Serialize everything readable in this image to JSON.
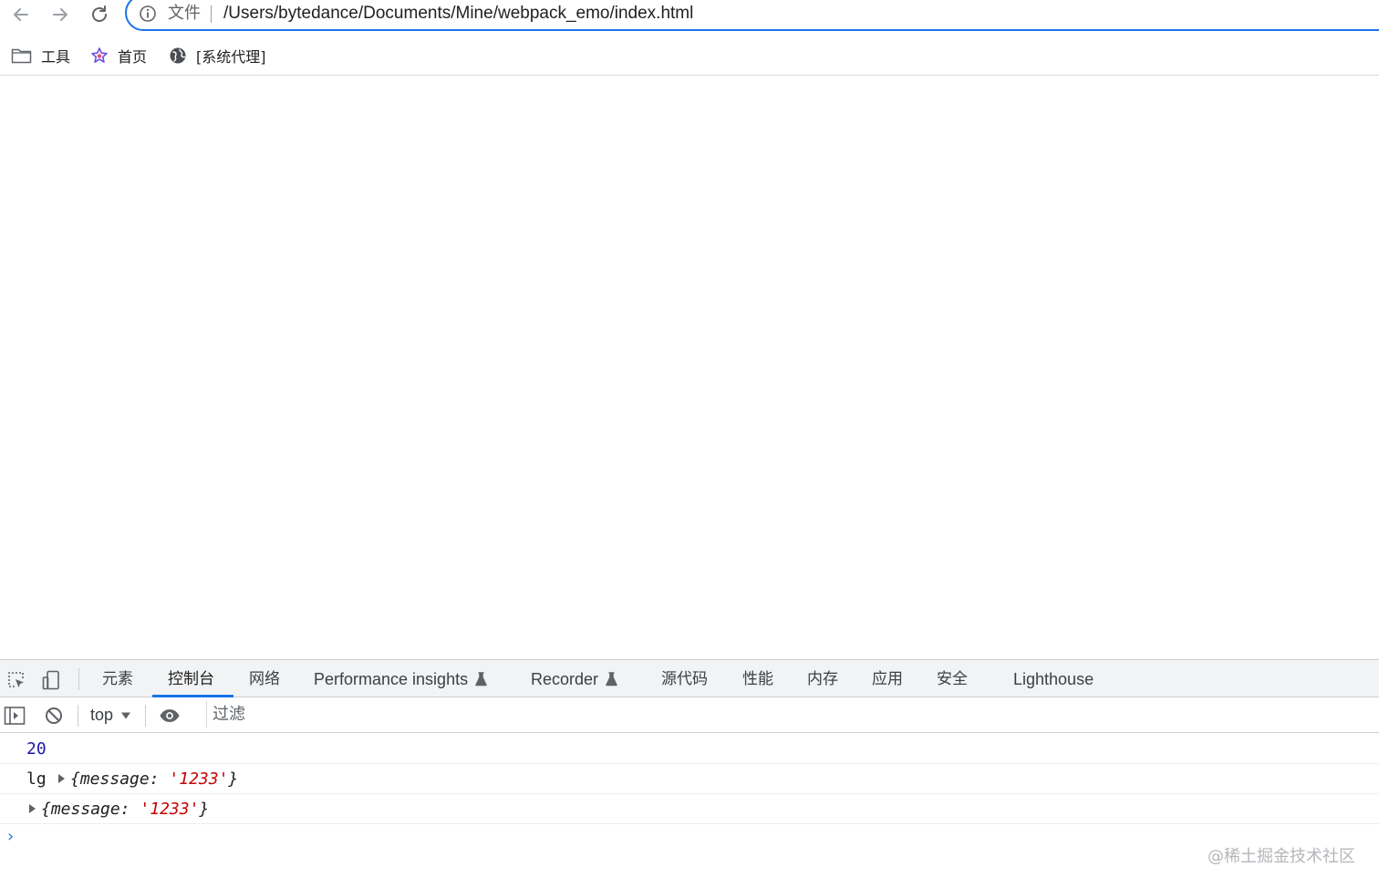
{
  "browser": {
    "scheme_label": "文件",
    "url": "/Users/bytedance/Documents/Mine/webpack_emo/index.html",
    "icons": {
      "back": "arrow-left-icon",
      "forward": "arrow-right-icon",
      "reload": "reload-icon",
      "info": "info-icon"
    }
  },
  "bookmarks": [
    {
      "label": "工具",
      "icon": "folder-icon"
    },
    {
      "label": "首页",
      "icon": "star-logo-icon"
    },
    {
      "label": "[系统代理]",
      "icon": "globe-icon"
    }
  ],
  "devtools": {
    "tabs": [
      {
        "label": "元素"
      },
      {
        "label": "控制台",
        "active": true
      },
      {
        "label": "网络"
      },
      {
        "label": "Performance insights",
        "experimental": true
      },
      {
        "label": "Recorder",
        "experimental": true
      },
      {
        "label": "源代码"
      },
      {
        "label": "性能"
      },
      {
        "label": "内存"
      },
      {
        "label": "应用"
      },
      {
        "label": "安全"
      },
      {
        "label": "Lighthouse"
      }
    ],
    "console_toolbar": {
      "context": "top",
      "filter_placeholder": "过滤"
    },
    "console_lines": [
      {
        "value": "20"
      },
      {
        "prefix": "lg",
        "obj_open": "{",
        "key": "message",
        "sep": ": ",
        "str": "'1233'",
        "obj_close": "}"
      },
      {
        "obj_open": "{",
        "key": "message",
        "sep": ": ",
        "str": "'1233'",
        "obj_close": "}"
      }
    ],
    "prompt": "›"
  },
  "watermark": "@稀土掘金技术社区",
  "colors": {
    "accent": "#1a73e8",
    "string": "#c80000",
    "number": "#1a1aa6"
  }
}
